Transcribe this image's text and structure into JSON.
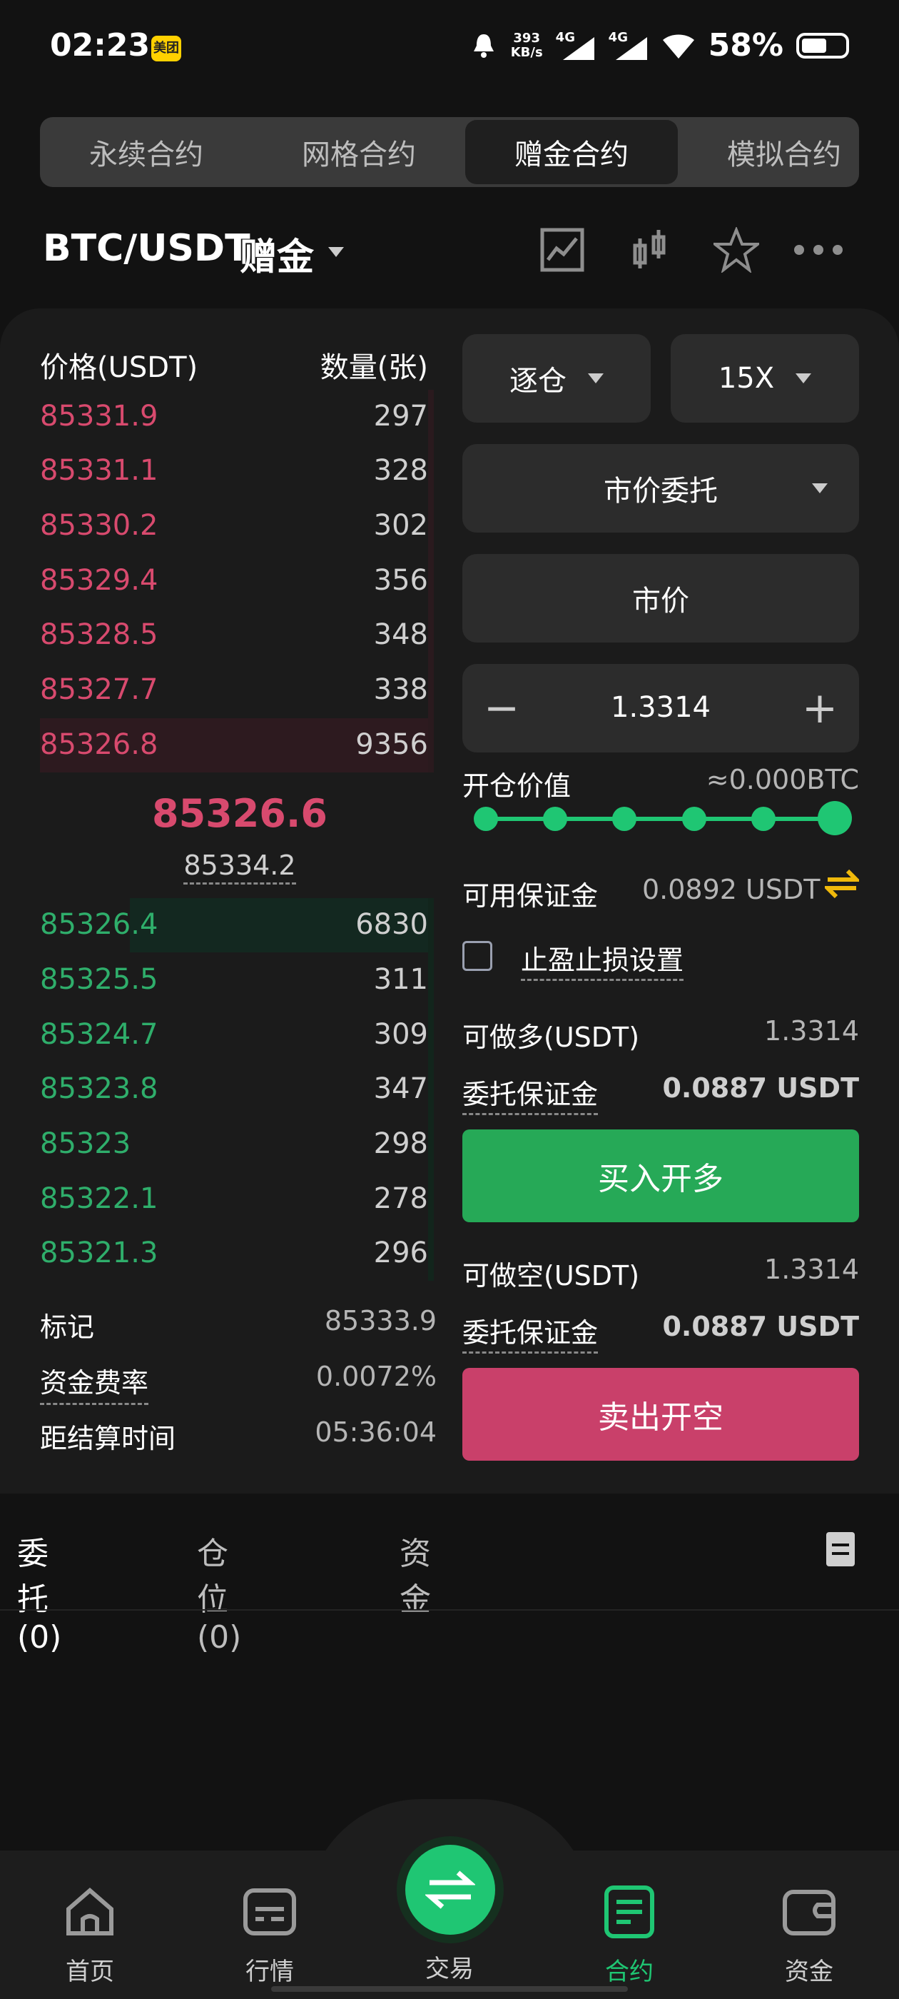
{
  "status_bar": {
    "time": "02:23",
    "app_badge": "美团",
    "net_speed_value": "393",
    "net_speed_unit": "KB/s",
    "signal_1": "4G",
    "signal_2": "4G",
    "battery": "58%"
  },
  "contract_tabs": [
    "永续合约",
    "网格合约",
    "赠金合约",
    "模拟合约"
  ],
  "active_contract_tab": "赠金合约",
  "pair": {
    "symbol": "BTC/USDT",
    "badge": "赠金"
  },
  "orderbook": {
    "price_header": "价格(USDT)",
    "qty_header": "数量(张)",
    "asks": [
      {
        "price": "85331.9",
        "qty": "297"
      },
      {
        "price": "85331.1",
        "qty": "328"
      },
      {
        "price": "85330.2",
        "qty": "302"
      },
      {
        "price": "85329.4",
        "qty": "356"
      },
      {
        "price": "85328.5",
        "qty": "348"
      },
      {
        "price": "85327.7",
        "qty": "338"
      },
      {
        "price": "85326.8",
        "qty": "9356"
      }
    ],
    "last_price": "85326.6",
    "mark_price": "85334.2",
    "bids": [
      {
        "price": "85326.4",
        "qty": "6830"
      },
      {
        "price": "85325.5",
        "qty": "311"
      },
      {
        "price": "85324.7",
        "qty": "309"
      },
      {
        "price": "85323.8",
        "qty": "347"
      },
      {
        "price": "85323",
        "qty": "298"
      },
      {
        "price": "85322.1",
        "qty": "278"
      },
      {
        "price": "85321.3",
        "qty": "296"
      }
    ]
  },
  "stats": [
    {
      "label": "标记",
      "value": "85333.9"
    },
    {
      "label": "资金费率",
      "value": "0.0072%"
    },
    {
      "label": "距结算时间",
      "value": "05:36:04"
    }
  ],
  "form": {
    "margin_mode": "逐仓",
    "leverage": "15X",
    "order_type": "市价委托",
    "price_field": "市价",
    "quantity": "1.3314",
    "minus": "−",
    "plus": "+",
    "open_value_label": "开仓价值",
    "open_value": "≈0.000BTC",
    "slider_level": 1.0,
    "available_label": "可用保证金",
    "available_value": "0.0892 USDT",
    "tpsl_label": "止盈止损设置",
    "long_label": "可做多(USDT)",
    "long_value": "1.3314",
    "long_margin_label": "委托保证金",
    "long_margin_value": "0.0887 USDT",
    "buy_button": "买入开多",
    "short_label": "可做空(USDT)",
    "short_value": "1.3314",
    "short_margin_label": "委托保证金",
    "short_margin_value": "0.0887 USDT",
    "sell_button": "卖出开空"
  },
  "order_tabs": [
    "委托(0)",
    "仓位(0)",
    "资金"
  ],
  "bottom_nav": [
    "首页",
    "行情",
    "交易",
    "合约",
    "资金"
  ],
  "active_nav": "合约",
  "colors": {
    "ask": "#d84a6e",
    "bid": "#2fae6b",
    "accent": "#1fc673",
    "buy": "#26a957",
    "sell": "#c9406a",
    "swap_icon": "#f0b90b"
  }
}
